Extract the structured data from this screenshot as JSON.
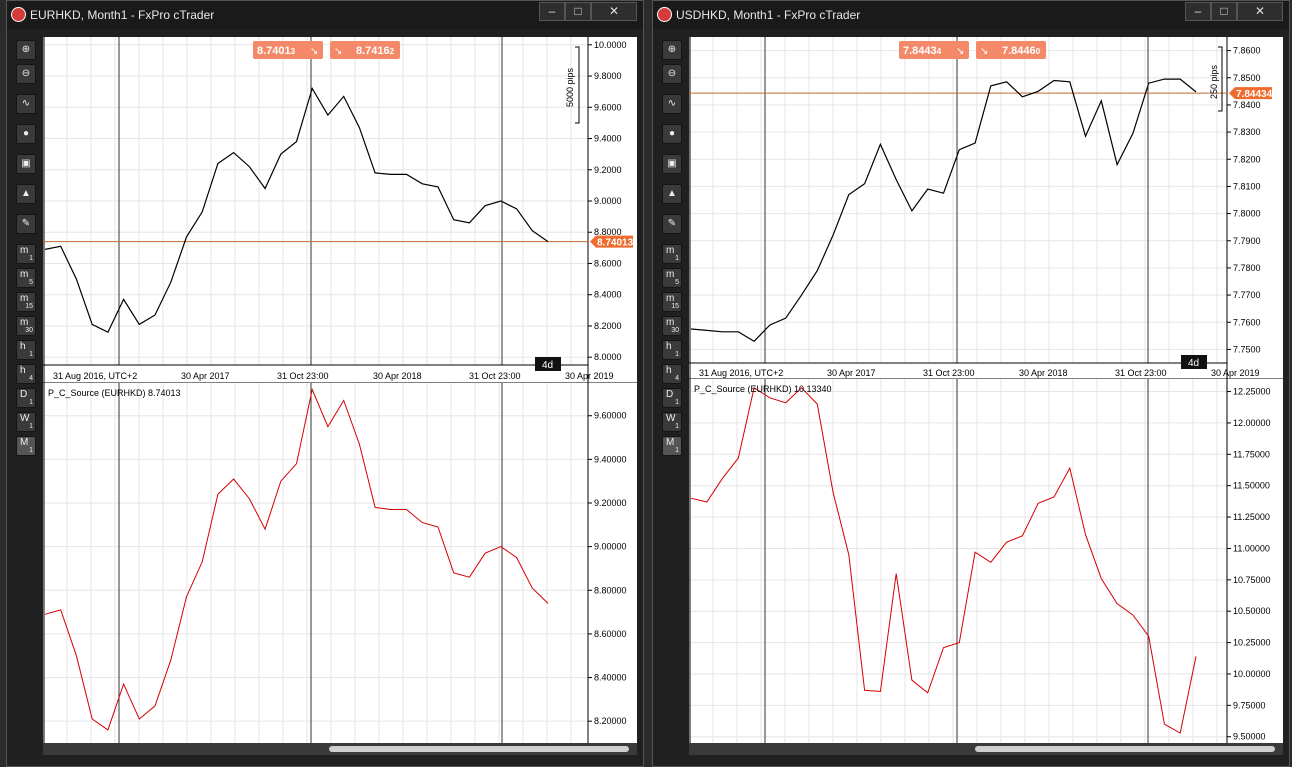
{
  "windows": [
    {
      "title": "EURHKD, Month1 - FxPro cTrader",
      "bid": "8.7401",
      "bid_pip": "3",
      "ask": "8.7416",
      "ask_pip": "2",
      "pips_label": "5000 pips",
      "price_tag": "8.74013",
      "timeframe_badge": "4d",
      "price_axis": [
        "10.0000",
        "9.8000",
        "9.6000",
        "9.4000",
        "9.2000",
        "9.0000",
        "8.8000",
        "8.6000",
        "8.4000",
        "8.2000",
        "8.0000"
      ],
      "time_axis": [
        "31 Aug 2016, UTC+2",
        "30 Apr 2017",
        "31 Oct 23:00",
        "30 Apr 2018",
        "31 Oct 23:00",
        "30 Apr 2019"
      ],
      "indicator_label": "P_C_Source (EURHKD) 8.74013",
      "indicator_axis": [
        "9.60000",
        "9.40000",
        "9.20000",
        "9.00000",
        "8.80000",
        "8.60000",
        "8.40000",
        "8.20000"
      ]
    },
    {
      "title": "USDHKD, Month1 - FxPro cTrader",
      "bid": "7.8443",
      "bid_pip": "4",
      "ask": "7.8446",
      "ask_pip": "0",
      "pips_label": "250 pips",
      "price_tag": "7.84434",
      "timeframe_badge": "4d",
      "price_axis": [
        "7.8600",
        "7.8500",
        "7.8400",
        "7.8300",
        "7.8200",
        "7.8100",
        "7.8000",
        "7.7900",
        "7.7800",
        "7.7700",
        "7.7600",
        "7.7500"
      ],
      "time_axis": [
        "31 Aug 2016, UTC+2",
        "30 Apr 2017",
        "31 Oct 23:00",
        "30 Apr 2018",
        "31 Oct 23:00",
        "30 Apr 2019"
      ],
      "indicator_label": "P_C_Source (EURHKD) 10.13340",
      "indicator_axis": [
        "12.25000",
        "12.00000",
        "11.75000",
        "11.50000",
        "11.25000",
        "11.00000",
        "10.75000",
        "10.50000",
        "10.25000",
        "10.00000",
        "9.75000",
        "9.50000"
      ]
    }
  ],
  "toolbar": [
    "zoom-in",
    "zoom-out",
    "chart-type",
    "object-tools",
    "trade-watch",
    "drawing-tools",
    "chart-settings"
  ],
  "timeframes": [
    {
      "main": "m",
      "sub": "1"
    },
    {
      "main": "m",
      "sub": "5"
    },
    {
      "main": "m",
      "sub": "15"
    },
    {
      "main": "m",
      "sub": "30"
    },
    {
      "main": "h",
      "sub": "1"
    },
    {
      "main": "h",
      "sub": "4"
    },
    {
      "main": "D",
      "sub": "1"
    },
    {
      "main": "W",
      "sub": "1"
    },
    {
      "main": "M",
      "sub": "1"
    }
  ],
  "chart_data": [
    {
      "type": "line",
      "title": "EURHKD, Month1",
      "series": [
        {
          "name": "EURHKD",
          "values": [
            8.69,
            8.71,
            8.5,
            8.21,
            8.16,
            8.37,
            8.21,
            8.27,
            8.48,
            8.77,
            8.93,
            9.24,
            9.31,
            9.22,
            9.08,
            9.3,
            9.38,
            9.72,
            9.55,
            9.67,
            9.47,
            9.18,
            9.17,
            9.17,
            9.11,
            9.09,
            8.88,
            8.86,
            8.97,
            9.0,
            8.95,
            8.81,
            8.74
          ]
        }
      ],
      "ylim": [
        7.95,
        10.05
      ],
      "current": 8.74013
    },
    {
      "type": "line",
      "title": "P_C_Source (EURHKD)",
      "series": [
        {
          "name": "P_C_Source",
          "values": [
            8.69,
            8.71,
            8.5,
            8.21,
            8.16,
            8.37,
            8.21,
            8.27,
            8.48,
            8.77,
            8.93,
            9.24,
            9.31,
            9.22,
            9.08,
            9.3,
            9.38,
            9.72,
            9.55,
            9.67,
            9.47,
            9.18,
            9.17,
            9.17,
            9.11,
            9.09,
            8.88,
            8.86,
            8.97,
            9.0,
            8.95,
            8.81,
            8.74
          ]
        }
      ],
      "ylim": [
        8.1,
        9.75
      ]
    },
    {
      "type": "line",
      "title": "USDHKD, Month1",
      "series": [
        {
          "name": "USDHKD",
          "values": [
            7.7575,
            7.757,
            7.7565,
            7.7565,
            7.753,
            7.759,
            7.7615,
            7.77,
            7.779,
            7.792,
            7.807,
            7.811,
            7.8255,
            7.8125,
            7.801,
            7.809,
            7.8075,
            7.8235,
            7.826,
            7.847,
            7.8485,
            7.843,
            7.845,
            7.849,
            7.8485,
            7.8285,
            7.8415,
            7.818,
            7.8295,
            7.848,
            7.8495,
            7.8495,
            7.8448
          ]
        }
      ],
      "ylim": [
        7.745,
        7.865
      ],
      "current": 7.84434
    },
    {
      "type": "line",
      "title": "P_C_Source (EURHKD)",
      "series": [
        {
          "name": "P_C_Source",
          "values": [
            11.4,
            11.37,
            11.56,
            11.72,
            12.28,
            12.2,
            12.16,
            12.28,
            12.15,
            11.45,
            10.95,
            9.87,
            9.86,
            10.8,
            9.95,
            9.85,
            10.21,
            10.25,
            10.97,
            10.89,
            11.05,
            11.1,
            11.36,
            11.41,
            11.64,
            11.11,
            10.76,
            10.56,
            10.47,
            10.3,
            9.6,
            9.53,
            10.14
          ]
        }
      ],
      "ylim": [
        9.45,
        12.35
      ]
    }
  ]
}
